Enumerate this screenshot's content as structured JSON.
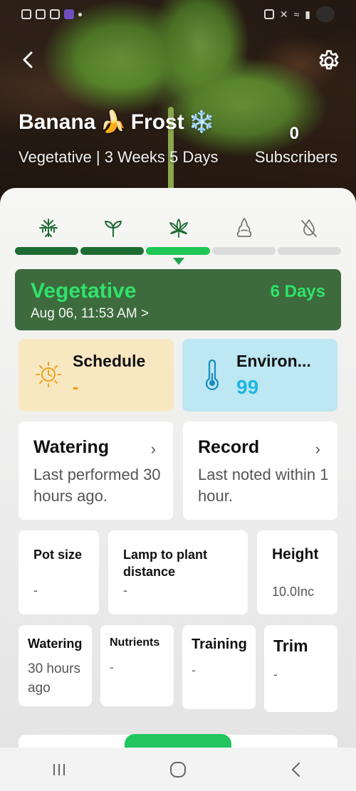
{
  "status_bar": {
    "icons": [
      "msg-icon",
      "gallery-icon",
      "instagram-icon",
      "app-icon",
      "dot-icon",
      "nfc-icon",
      "mute-icon",
      "wifi-icon",
      "signal-icon",
      "battery-icon"
    ]
  },
  "header": {
    "plant_name": "Banana",
    "plant_name_2": "Frost",
    "emoji_1": "🍌",
    "emoji_2": "❄️",
    "subtitle": "Vegetative | 3 Weeks 5 Days",
    "subscribers_count": "0",
    "subscribers_label": "Subscribers"
  },
  "stages": {
    "icons": [
      "germination-icon",
      "seedling-icon",
      "vegetative-icon",
      "flowering-icon",
      "harvest-icon"
    ],
    "progress": [
      "done",
      "done",
      "active",
      "pending",
      "pending"
    ]
  },
  "current_stage": {
    "name": "Vegetative",
    "duration": "6 Days",
    "start": "Aug 06, 11:53 AM >"
  },
  "schedule": {
    "title": "Schedule",
    "value": "-"
  },
  "environment": {
    "title": "Environ...",
    "value": "99"
  },
  "watering_card": {
    "title": "Watering",
    "text": "Last performed 30 hours ago."
  },
  "record_card": {
    "title": "Record",
    "text": "Last noted within 1 hour."
  },
  "stats": {
    "pot_size": {
      "label": "Pot size",
      "value": "-"
    },
    "lamp_distance": {
      "label": "Lamp to plant distance",
      "value": "-"
    },
    "height": {
      "label": "Height",
      "value": "10.0Inc"
    }
  },
  "small_tiles": {
    "watering": {
      "label": "Watering",
      "value": "30 hours ago"
    },
    "nutrients": {
      "label": "Nutrients",
      "value": "-"
    },
    "training": {
      "label": "Training",
      "value": "-"
    },
    "trim": {
      "label": "Trim",
      "value": "-"
    }
  },
  "colors": {
    "stage_done": "#1d6a33",
    "stage_active": "#1fc755",
    "stage_card_bg": "#3d6b3e",
    "stage_text": "#2fe36a",
    "schedule_bg": "#f7e8c2",
    "env_bg": "#bde7f2",
    "env_value": "#1cb7e0",
    "schedule_value": "#f39a1c"
  },
  "navigation": {
    "icons": [
      "recents-icon",
      "home-icon",
      "back-icon"
    ]
  }
}
